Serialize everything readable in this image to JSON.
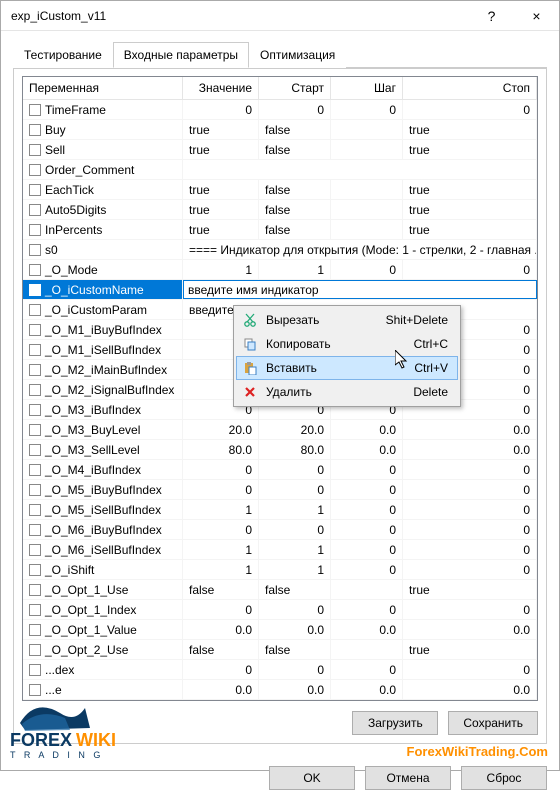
{
  "window": {
    "title": "exp_iCustom_v11",
    "help_tooltip": "?",
    "close_tooltip": "×"
  },
  "tabs": [
    "Тестирование",
    "Входные параметры",
    "Оптимизация"
  ],
  "active_tab": 1,
  "columns": {
    "name": "Переменная",
    "value": "Значение",
    "start": "Старт",
    "step": "Шаг",
    "stop": "Стоп"
  },
  "rows": [
    {
      "name": "TimeFrame",
      "value": "0",
      "start": "0",
      "step": "0",
      "stop": "0",
      "valtype": "num"
    },
    {
      "name": "Buy",
      "value": "true",
      "start": "false",
      "step": "",
      "stop": "true",
      "valtype": "text"
    },
    {
      "name": "Sell",
      "value": "true",
      "start": "false",
      "step": "",
      "stop": "true",
      "valtype": "text"
    },
    {
      "name": "Order_Comment",
      "value": "",
      "start": "",
      "step": "",
      "stop": "",
      "valtype": "text",
      "span": true
    },
    {
      "name": "EachTick",
      "value": "true",
      "start": "false",
      "step": "",
      "stop": "true",
      "valtype": "text"
    },
    {
      "name": "Auto5Digits",
      "value": "true",
      "start": "false",
      "step": "",
      "stop": "true",
      "valtype": "text"
    },
    {
      "name": "InPercents",
      "value": "true",
      "start": "false",
      "step": "",
      "stop": "true",
      "valtype": "text"
    },
    {
      "name": "s0",
      "value": "==== Индикатор для открытия (Mode: 1 - стрелки, 2 - главная ...",
      "span": true,
      "valtype": "text"
    },
    {
      "name": "_O_Mode",
      "value": "1",
      "start": "1",
      "step": "0",
      "stop": "0",
      "valtype": "num"
    },
    {
      "name": "_O_iCustomName",
      "value": "введите имя индикатор",
      "span": true,
      "selected": true,
      "editing": true,
      "valtype": "text"
    },
    {
      "name": "_O_iCustomParam",
      "value": "введите список парам",
      "span": true,
      "valtype": "text"
    },
    {
      "name": "_O_M1_iBuyBufIndex",
      "value": "0",
      "start": "",
      "step": "",
      "stop": "0",
      "valtype": "num"
    },
    {
      "name": "_O_M1_iSellBufIndex",
      "value": "1",
      "start": "",
      "step": "",
      "stop": "0",
      "valtype": "num"
    },
    {
      "name": "_O_M2_iMainBufIndex",
      "value": "0",
      "start": "",
      "step": "",
      "stop": "0",
      "valtype": "num"
    },
    {
      "name": "_O_M2_iSignalBufIndex",
      "value": "1",
      "start": "",
      "step": "",
      "stop": "0",
      "valtype": "num"
    },
    {
      "name": "_O_M3_iBufIndex",
      "value": "0",
      "start": "0",
      "step": "0",
      "stop": "0",
      "valtype": "num"
    },
    {
      "name": "_O_M3_BuyLevel",
      "value": "20.0",
      "start": "20.0",
      "step": "0.0",
      "stop": "0.0",
      "valtype": "num"
    },
    {
      "name": "_O_M3_SellLevel",
      "value": "80.0",
      "start": "80.0",
      "step": "0.0",
      "stop": "0.0",
      "valtype": "num"
    },
    {
      "name": "_O_M4_iBufIndex",
      "value": "0",
      "start": "0",
      "step": "0",
      "stop": "0",
      "valtype": "num"
    },
    {
      "name": "_O_M5_iBuyBufIndex",
      "value": "0",
      "start": "0",
      "step": "0",
      "stop": "0",
      "valtype": "num"
    },
    {
      "name": "_O_M5_iSellBufIndex",
      "value": "1",
      "start": "1",
      "step": "0",
      "stop": "0",
      "valtype": "num"
    },
    {
      "name": "_O_M6_iBuyBufIndex",
      "value": "0",
      "start": "0",
      "step": "0",
      "stop": "0",
      "valtype": "num"
    },
    {
      "name": "_O_M6_iSellBufIndex",
      "value": "1",
      "start": "1",
      "step": "0",
      "stop": "0",
      "valtype": "num"
    },
    {
      "name": "_O_iShift",
      "value": "1",
      "start": "1",
      "step": "0",
      "stop": "0",
      "valtype": "num"
    },
    {
      "name": "_O_Opt_1_Use",
      "value": "false",
      "start": "false",
      "step": "",
      "stop": "true",
      "valtype": "text"
    },
    {
      "name": "_O_Opt_1_Index",
      "value": "0",
      "start": "0",
      "step": "0",
      "stop": "0",
      "valtype": "num"
    },
    {
      "name": "_O_Opt_1_Value",
      "value": "0.0",
      "start": "0.0",
      "step": "0.0",
      "stop": "0.0",
      "valtype": "num"
    },
    {
      "name": "_O_Opt_2_Use",
      "value": "false",
      "start": "false",
      "step": "",
      "stop": "true",
      "valtype": "text"
    },
    {
      "name": "...dex",
      "value": "0",
      "start": "0",
      "step": "0",
      "stop": "0",
      "valtype": "num"
    },
    {
      "name": "...e",
      "value": "0.0",
      "start": "0.0",
      "step": "0.0",
      "stop": "0.0",
      "valtype": "num"
    }
  ],
  "context_menu": {
    "items": [
      {
        "icon": "cut",
        "label": "Вырезать",
        "shortcut": "Shit+Delete"
      },
      {
        "icon": "copy",
        "label": "Копировать",
        "shortcut": "Ctrl+C"
      },
      {
        "icon": "paste",
        "label": "Вставить",
        "shortcut": "Ctrl+V",
        "hover": true
      },
      {
        "icon": "delete",
        "label": "Удалить",
        "shortcut": "Delete"
      }
    ]
  },
  "buttons": {
    "load": "Загрузить",
    "save": "Сохранить",
    "ok": "OK",
    "cancel": "Отмена",
    "reset": "Сброс"
  },
  "watermark": "ForexWikiTrading.Com",
  "logo": {
    "top": "FOREX",
    "mid": "WIKI",
    "bottom": "T R A D I N G"
  }
}
